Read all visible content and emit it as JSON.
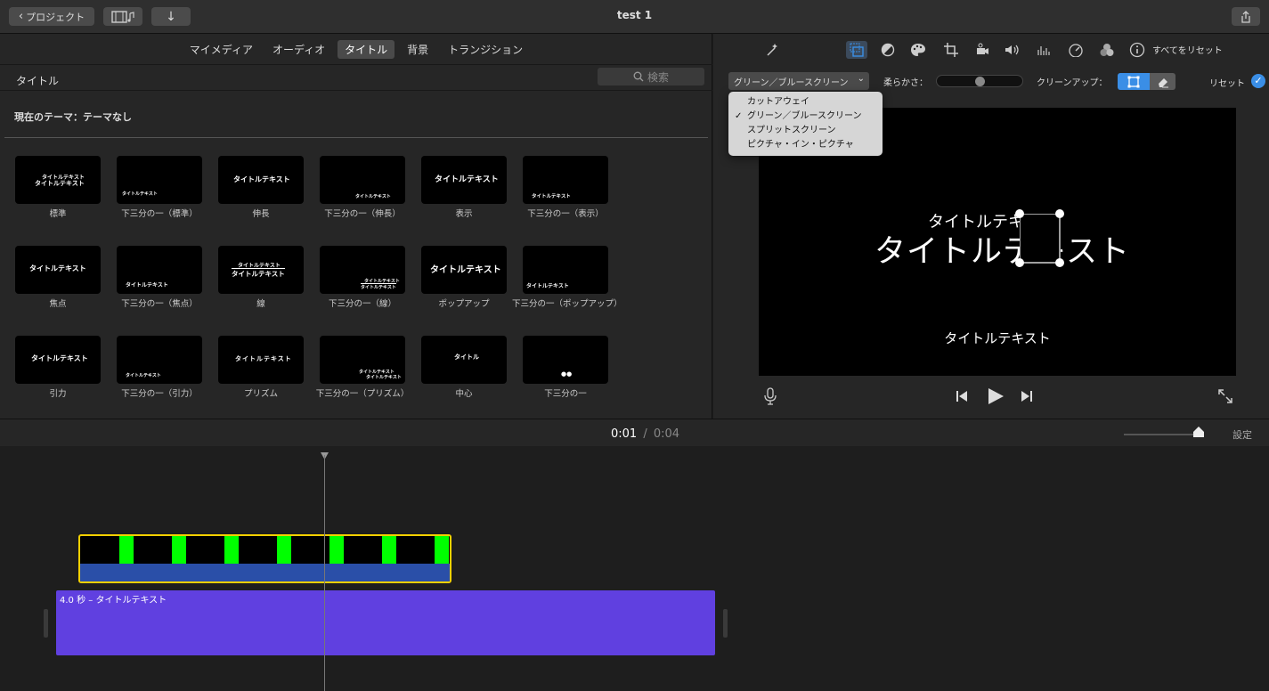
{
  "window": {
    "title": "test 1"
  },
  "toolbar": {
    "back_label": "プロジェクト"
  },
  "browser": {
    "tabs": [
      {
        "label": "マイメディア",
        "active": false
      },
      {
        "label": "オーディオ",
        "active": false
      },
      {
        "label": "タイトル",
        "active": true
      },
      {
        "label": "背景",
        "active": false
      },
      {
        "label": "トランジション",
        "active": false
      }
    ],
    "section_title": "タイトル",
    "search_placeholder": "検索",
    "theme_label": "現在のテーマ：テーマなし",
    "titles": [
      {
        "label": "標準",
        "preview": "タイトルテキスト"
      },
      {
        "label": "下三分の一（標準）",
        "preview": "タイトルテキスト"
      },
      {
        "label": "伸長",
        "preview": "タイトルテキスト"
      },
      {
        "label": "下三分の一（伸長）",
        "preview": "タイトルテキスト"
      },
      {
        "label": "表示",
        "preview": "タイトルテキスト"
      },
      {
        "label": "下三分の一（表示）",
        "preview": "タイトルテキスト"
      },
      {
        "label": "焦点",
        "preview": "タイトルテキスト"
      },
      {
        "label": "下三分の一（焦点）",
        "preview": "タイトルテキスト"
      },
      {
        "label": "線",
        "preview": "タイトルテキスト"
      },
      {
        "label": "下三分の一（線）",
        "preview": "タイトルテキスト"
      },
      {
        "label": "ポップアップ",
        "preview": "タイトルテキスト"
      },
      {
        "label": "下三分の一（ポップアップ）",
        "preview": "タイトルテキスト"
      },
      {
        "label": "引力",
        "preview": "タイトルテキスト"
      },
      {
        "label": "下三分の一（引力）",
        "preview": "タイトルテキスト"
      },
      {
        "label": "プリズム",
        "preview": "タイトルテキスト"
      },
      {
        "label": "下三分の一（プリズム）",
        "preview": "タイトルテキスト"
      },
      {
        "label": "中心",
        "preview": "タイトル"
      },
      {
        "label": "下三分の一",
        "preview": ""
      }
    ]
  },
  "inspector": {
    "reset_all_label": "すべてをリセット",
    "overlay_selected": "グリーン／ブルースクリーン",
    "softness_label": "柔らかさ：",
    "softness_value": 0.5,
    "cleanup_label": "クリーンアップ：",
    "reset_label": "リセット",
    "menu_items": [
      {
        "label": "カットアウェイ",
        "checked": false
      },
      {
        "label": "グリーン／ブルースクリーン",
        "checked": true
      },
      {
        "label": "スプリットスクリーン",
        "checked": false
      },
      {
        "label": "ピクチャ・イン・ピクチャ",
        "checked": false
      }
    ],
    "checkmark": "✓"
  },
  "viewer": {
    "small_title": "タイトルテキスト",
    "big_title": "タイトルテキスト",
    "subtitle": "タイトルテキスト"
  },
  "timeline": {
    "current_time": "0:01",
    "separator": "/",
    "total_time": "0:04",
    "settings_label": "設定",
    "zoom_value": 0.95,
    "clip_label": "4.0 秒 – タイトルテキスト"
  },
  "colors": {
    "accent": "#3a8ee6",
    "green_clip": "#00ff00",
    "title_clip": "#6040e0",
    "selection": "#f5d000"
  }
}
